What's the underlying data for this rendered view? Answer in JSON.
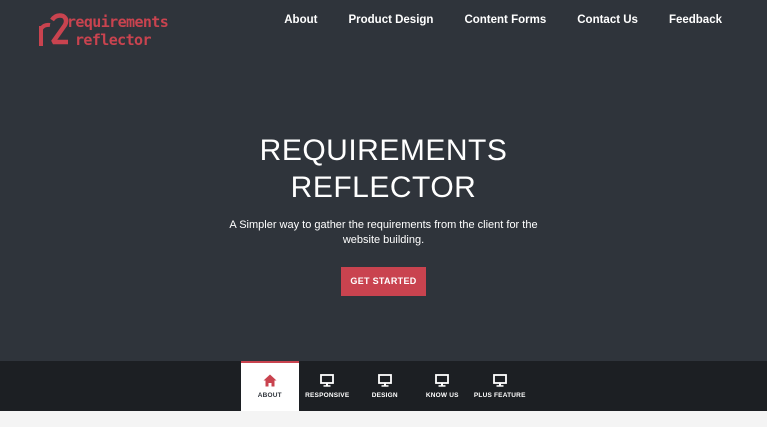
{
  "brand": {
    "logo_line1": "requirements",
    "logo_line2": "reflector",
    "accent_color": "#c9434f"
  },
  "nav": {
    "items": [
      {
        "label": "About"
      },
      {
        "label": "Product Design"
      },
      {
        "label": "Content Forms"
      },
      {
        "label": "Contact Us"
      },
      {
        "label": "Feedback"
      }
    ]
  },
  "hero": {
    "title_line1": "REQUIREMENTS",
    "title_line2": "REFLECTOR",
    "subtitle": "A Simpler way to gather the requirements from the client for the website building.",
    "cta_label": "GET STARTED"
  },
  "tabs": [
    {
      "label": "ABOUT",
      "icon": "home-icon",
      "active": true
    },
    {
      "label": "RESPONSIVE",
      "icon": "monitor-icon",
      "active": false
    },
    {
      "label": "DESIGN",
      "icon": "monitor-icon",
      "active": false
    },
    {
      "label": "KNOW US",
      "icon": "monitor-icon",
      "active": false
    },
    {
      "label": "PLUS FEATURE",
      "icon": "monitor-icon",
      "active": false
    }
  ],
  "colors": {
    "background": "#2f343b",
    "tabbar": "#1c1f23",
    "accent": "#c9434f"
  }
}
